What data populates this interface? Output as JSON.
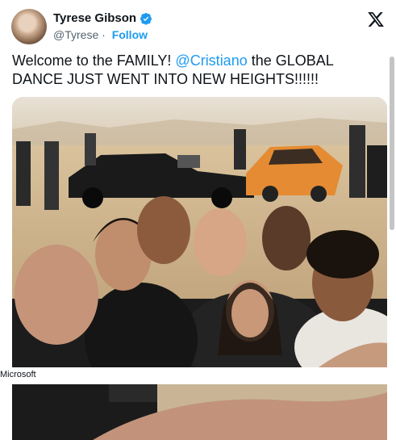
{
  "post": {
    "author_name": "Tyrese Gibson",
    "handle": "@Tyrese",
    "separator": "·",
    "follow_label": "Follow",
    "text_before": "Welcome to the FAMILY! ",
    "mention": "@Cristiano",
    "text_after": " the GLOBAL DANCE JUST WENT INTO NEW HEIGHTS!!!!!!",
    "image_caption": "Microsoft"
  },
  "icons": {
    "verified": "verified-badge-icon",
    "platform": "x-logo-icon"
  },
  "colors": {
    "accent": "#1d9bf0",
    "text": "#0f1419",
    "muted": "#536471"
  }
}
